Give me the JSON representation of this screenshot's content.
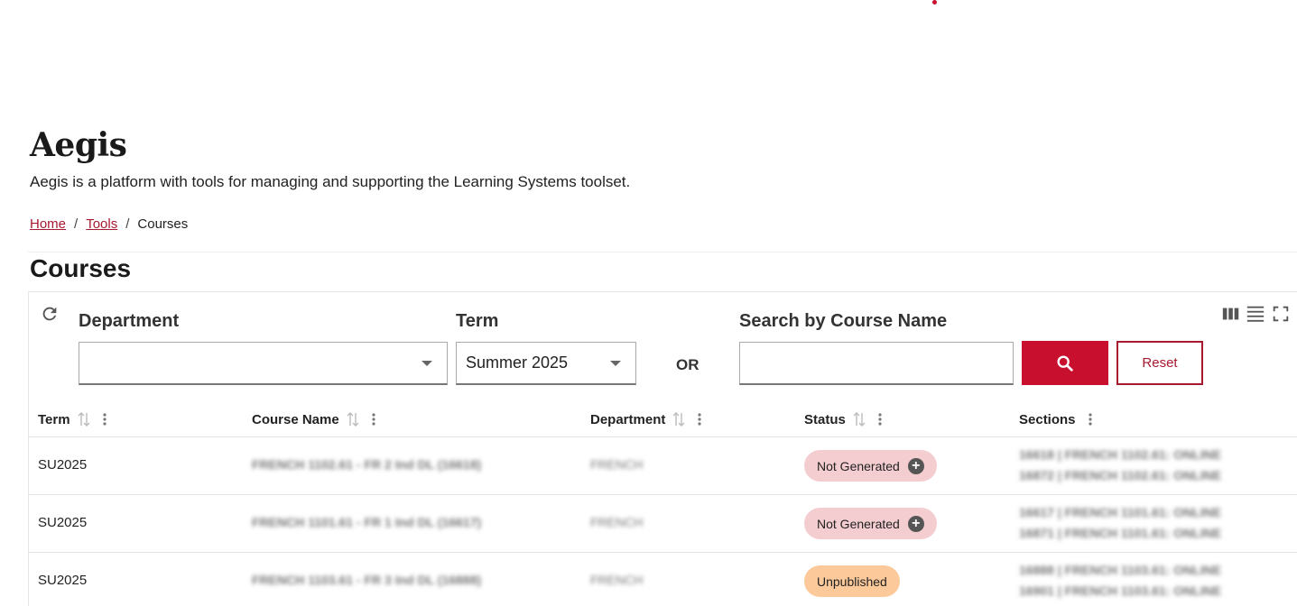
{
  "app": {
    "title": "Aegis",
    "description": "Aegis is a platform with tools for managing and supporting the Learning Systems toolset."
  },
  "breadcrumb": {
    "home": "Home",
    "tools": "Tools",
    "current": "Courses",
    "separator": "/"
  },
  "page": {
    "title": "Courses"
  },
  "filters": {
    "department_label": "Department",
    "department_value": "",
    "term_label": "Term",
    "term_value": "Summer 2025",
    "or_label": "OR",
    "search_label": "Search by Course Name",
    "search_value": "",
    "reset_label": "Reset"
  },
  "table": {
    "columns": [
      "Term",
      "Course Name",
      "Department",
      "Status",
      "Sections"
    ],
    "rows": [
      {
        "term": "SU2025",
        "course_name": "FRENCH 1102.61 - FR 2 Ind DL (16618)",
        "department": "FRENCH",
        "status": "Not Generated",
        "sections": [
          "16618 | FRENCH 1102.61: ONLINE",
          "16872 | FRENCH 1102.61: ONLINE"
        ]
      },
      {
        "term": "SU2025",
        "course_name": "FRENCH 1101.61 - FR 1 Ind DL (16617)",
        "department": "FRENCH",
        "status": "Not Generated",
        "sections": [
          "16617 | FRENCH 1101.61: ONLINE",
          "16871 | FRENCH 1101.61: ONLINE"
        ]
      },
      {
        "term": "SU2025",
        "course_name": "FRENCH 1103.61 - FR 3 Ind DL (16888)",
        "department": "FRENCH",
        "status": "Unpublished",
        "sections": [
          "16888 | FRENCH 1103.61: ONLINE",
          "16901 | FRENCH 1103.61: ONLINE"
        ]
      }
    ]
  },
  "colors": {
    "brand": "#c8102e",
    "link": "#a6192e",
    "status_not_generated": "#f4cdd1",
    "status_unpublished": "#fbc99a"
  },
  "icons": {
    "refresh": "refresh-icon",
    "search": "search-icon",
    "columns": "columns-icon",
    "density": "density-icon",
    "fullscreen": "fullscreen-icon",
    "sort": "sort-icon",
    "kebab": "kebab-icon",
    "add": "plus-icon"
  }
}
